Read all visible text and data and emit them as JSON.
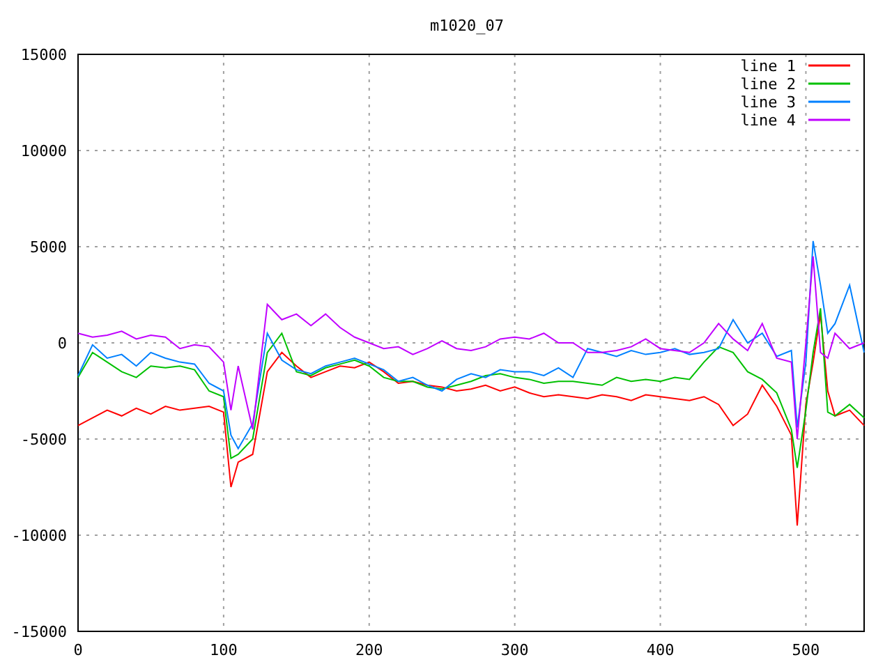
{
  "chart": {
    "chart_data": {
      "type": "line",
      "title": "m1020_07",
      "x": [
        0,
        10,
        20,
        30,
        40,
        50,
        60,
        70,
        80,
        90,
        100,
        105,
        110,
        120,
        130,
        140,
        150,
        160,
        170,
        180,
        190,
        200,
        210,
        220,
        230,
        240,
        250,
        260,
        270,
        280,
        290,
        300,
        310,
        320,
        330,
        340,
        350,
        360,
        370,
        380,
        390,
        400,
        410,
        420,
        430,
        440,
        450,
        460,
        470,
        480,
        490,
        494,
        500,
        505,
        510,
        515,
        520,
        530,
        540
      ],
      "series": [
        {
          "name": "line 1",
          "color": "#ff0000",
          "values": [
            -4300,
            -3900,
            -3500,
            -3800,
            -3400,
            -3700,
            -3300,
            -3500,
            -3400,
            -3300,
            -3600,
            -7500,
            -6200,
            -5800,
            -1500,
            -500,
            -1200,
            -1800,
            -1500,
            -1200,
            -1300,
            -1000,
            -1500,
            -2100,
            -2000,
            -2200,
            -2300,
            -2500,
            -2400,
            -2200,
            -2500,
            -2300,
            -2600,
            -2800,
            -2700,
            -2800,
            -2900,
            -2700,
            -2800,
            -3000,
            -2700,
            -2800,
            -2900,
            -3000,
            -2800,
            -3200,
            -4300,
            -3700,
            -2200,
            -3300,
            -4800,
            -9500,
            -3200,
            -1000,
            1500,
            -2500,
            -3800,
            -3500,
            -4300
          ]
        },
        {
          "name": "line 2",
          "color": "#00c000",
          "values": [
            -1800,
            -500,
            -1000,
            -1500,
            -1800,
            -1200,
            -1300,
            -1200,
            -1400,
            -2500,
            -2800,
            -6000,
            -5800,
            -5000,
            -500,
            500,
            -1500,
            -1700,
            -1300,
            -1100,
            -900,
            -1200,
            -1800,
            -2000,
            -2000,
            -2300,
            -2400,
            -2200,
            -2000,
            -1700,
            -1600,
            -1800,
            -1900,
            -2100,
            -2000,
            -2000,
            -2100,
            -2200,
            -1800,
            -2000,
            -1900,
            -2000,
            -1800,
            -1900,
            -1000,
            -200,
            -500,
            -1500,
            -1900,
            -2600,
            -4500,
            -6500,
            -3500,
            -500,
            1800,
            -3600,
            -3800,
            -3200,
            -3900
          ]
        },
        {
          "name": "line 3",
          "color": "#0080ff",
          "values": [
            -1700,
            -100,
            -800,
            -600,
            -1200,
            -500,
            -800,
            -1000,
            -1100,
            -2100,
            -2500,
            -4800,
            -5500,
            -4200,
            500,
            -900,
            -1400,
            -1600,
            -1200,
            -1000,
            -800,
            -1100,
            -1400,
            -2000,
            -1800,
            -2200,
            -2500,
            -1900,
            -1600,
            -1800,
            -1400,
            -1500,
            -1500,
            -1700,
            -1300,
            -1800,
            -300,
            -500,
            -700,
            -400,
            -600,
            -500,
            -300,
            -600,
            -500,
            -300,
            1200,
            0,
            500,
            -700,
            -400,
            -4400,
            -1000,
            5300,
            3000,
            500,
            1000,
            3000,
            -500
          ]
        },
        {
          "name": "line 4",
          "color": "#c000ff",
          "values": [
            500,
            300,
            400,
            600,
            200,
            400,
            300,
            -300,
            -100,
            -200,
            -1000,
            -3500,
            -1200,
            -4500,
            2000,
            1200,
            1500,
            900,
            1500,
            800,
            300,
            0,
            -300,
            -200,
            -600,
            -300,
            100,
            -300,
            -400,
            -200,
            200,
            300,
            200,
            500,
            0,
            0,
            -500,
            -500,
            -400,
            -200,
            200,
            -300,
            -400,
            -500,
            0,
            1000,
            200,
            -400,
            1000,
            -800,
            -1000,
            -5000,
            0,
            4500,
            -500,
            -800,
            500,
            -300,
            0
          ]
        }
      ],
      "xlim": [
        0,
        540
      ],
      "ylim": [
        -15000,
        15000
      ],
      "xticks": [
        0,
        100,
        200,
        300,
        400,
        500
      ],
      "yticks": [
        -15000,
        -10000,
        -5000,
        0,
        5000,
        10000,
        15000
      ],
      "grid": true,
      "legend": true
    }
  }
}
